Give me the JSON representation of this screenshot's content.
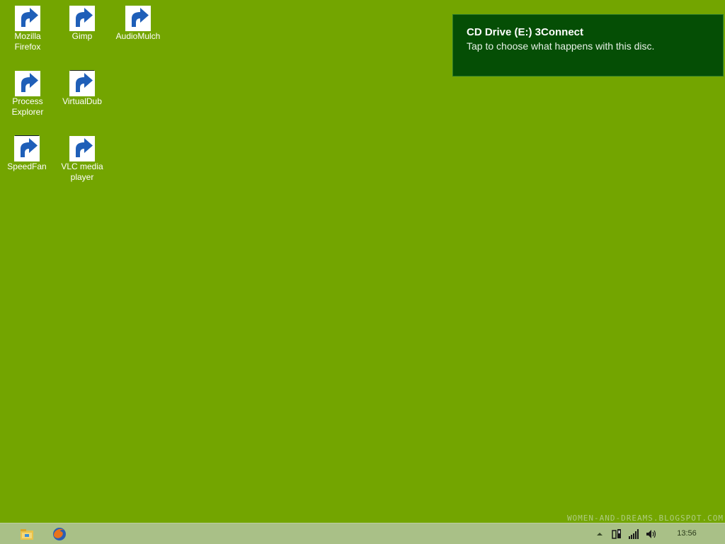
{
  "desktop": {
    "background": "#73a500",
    "icons": [
      {
        "label": "Mozilla\nFirefox",
        "icon": "firefox-icon"
      },
      {
        "label": "Gimp",
        "icon": "gimp-icon"
      },
      {
        "label": "AudioMulch",
        "icon": "audiomulch-icon"
      },
      {
        "label": "Process\nExplorer",
        "icon": "process-explorer-icon"
      },
      {
        "label": "VirtualDub",
        "icon": "virtualdub-icon"
      },
      {
        "label": "SpeedFan",
        "icon": "speedfan-icon"
      },
      {
        "label": "VLC media\nplayer",
        "icon": "vlc-icon"
      }
    ]
  },
  "notification": {
    "title": "CD Drive (E:) 3Connect",
    "body": "Tap to choose what happens with this disc."
  },
  "watermark": "WOMEN-AND-DREAMS.BLOGSPOT.COM",
  "taskbar": {
    "background": "#a9c087",
    "pinned": [
      "file-explorer-icon",
      "firefox-icon"
    ],
    "tray_icons": [
      "chevron-up-icon",
      "network-adapter-icon",
      "signal-bars-icon",
      "speaker-icon"
    ],
    "clock": "13:56"
  }
}
